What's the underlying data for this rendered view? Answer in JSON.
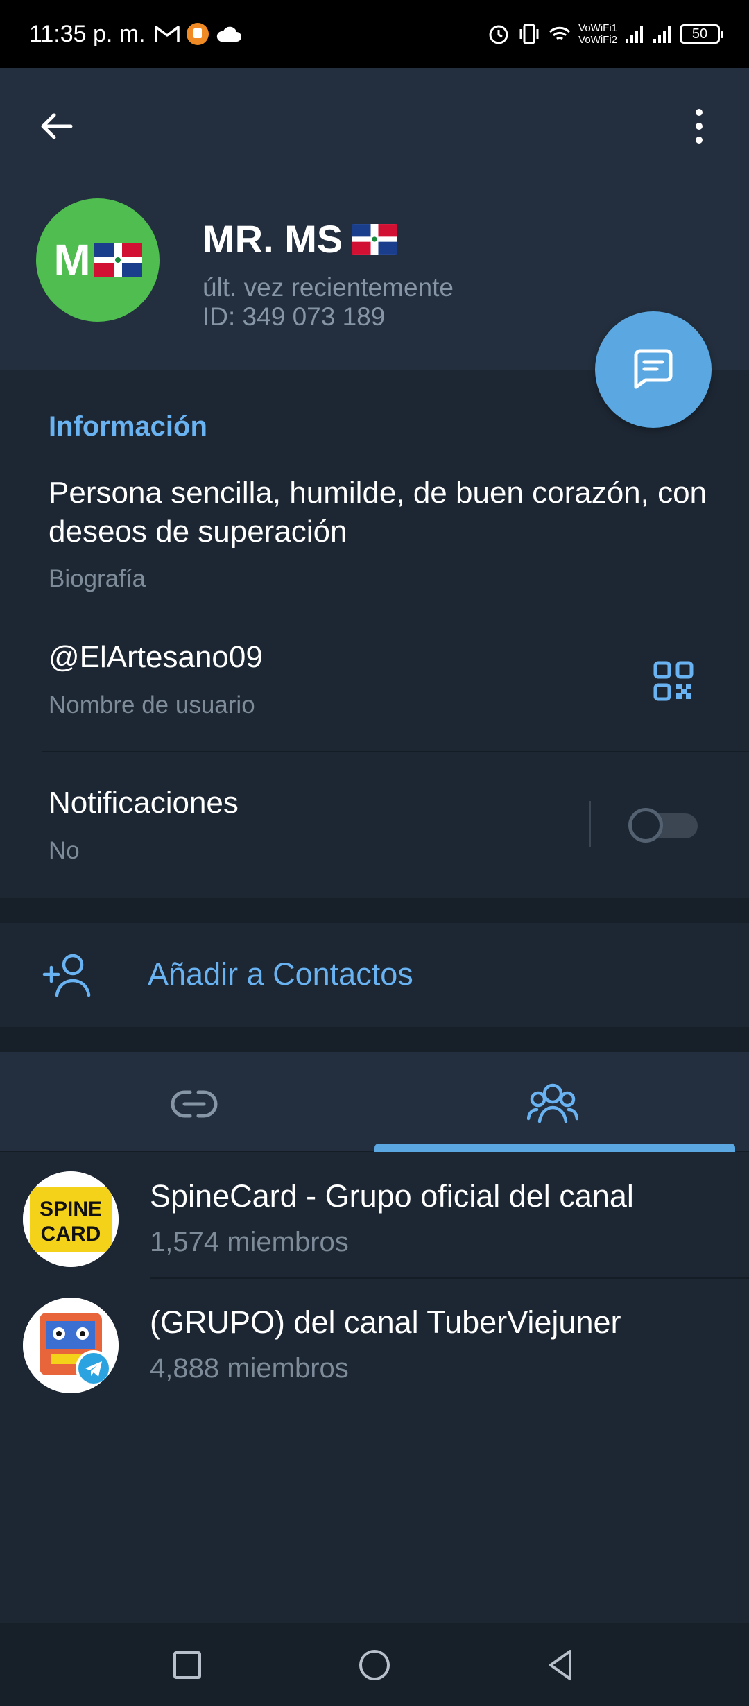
{
  "status_bar": {
    "time": "11:35 p. m.",
    "wifi_line1": "VoWiFi1",
    "wifi_line2": "VoWiFi2",
    "battery": "50"
  },
  "header": {
    "back_icon": "arrow-left-icon",
    "menu_icon": "more-vertical-icon",
    "avatar_letter": "M",
    "name": "MR. MS",
    "last_seen": "últ. vez recientemente",
    "user_id": "ID: 349 073 189",
    "fab_icon": "message-icon"
  },
  "info": {
    "title": "Información",
    "bio": "Persona sencilla, humilde, de buen corazón, con deseos de superación",
    "bio_label": "Biografía",
    "username": "@ElArtesano09",
    "username_label": "Nombre de usuario",
    "notifications_label": "Notificaciones",
    "notifications_value": "No",
    "notifications_on": false
  },
  "add_contact": {
    "label": "Añadir a Contactos",
    "icon": "add-user-icon"
  },
  "tabs": {
    "items": [
      "links-icon",
      "groups-icon"
    ],
    "active_index": 1
  },
  "groups": [
    {
      "name": "SpineCard - Grupo oficial del canal",
      "members": "1,574 miembros",
      "avatar_text_1": "SPINE",
      "avatar_text_2": "CARD"
    },
    {
      "name": "(GRUPO) del canal TuberViejuner",
      "members": "4,888 miembros"
    }
  ],
  "colors": {
    "accent": "#6ab3f3",
    "fab": "#5aa7e2",
    "avatar": "#4fbd50",
    "background": "#1d2733",
    "header": "#232f3e"
  }
}
